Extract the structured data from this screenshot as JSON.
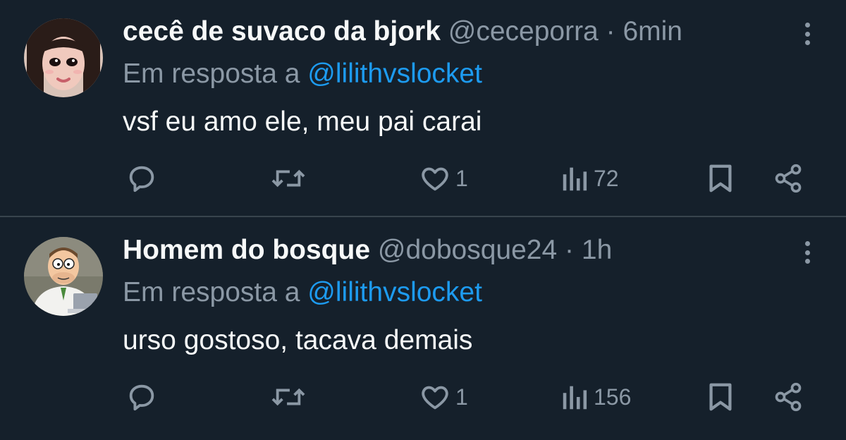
{
  "tweets": [
    {
      "name": "cecê de suvaco da bjork",
      "handle": "@ceceporra",
      "separator": "·",
      "time": "6min",
      "reply_prefix": "Em resposta a",
      "reply_to": "@lilithvslocket",
      "text": "vsf eu amo ele, meu pai carai",
      "likes": "1",
      "views": "72",
      "avatar_icon": "avatar-girl-photo"
    },
    {
      "name": "Homem do bosque",
      "handle": "@dobosque24",
      "separator": "·",
      "time": "1h",
      "reply_prefix": "Em resposta a",
      "reply_to": "@lilithvslocket",
      "text": "urso gostoso, tacava demais",
      "likes": "1",
      "views": "156",
      "avatar_icon": "avatar-cartoon-man-laptop"
    }
  ],
  "colors": {
    "background": "#15202b",
    "primary_text": "#f7f9f9",
    "secondary_text": "#8b98a5",
    "link": "#1d9bf0",
    "divider": "#38444d"
  }
}
